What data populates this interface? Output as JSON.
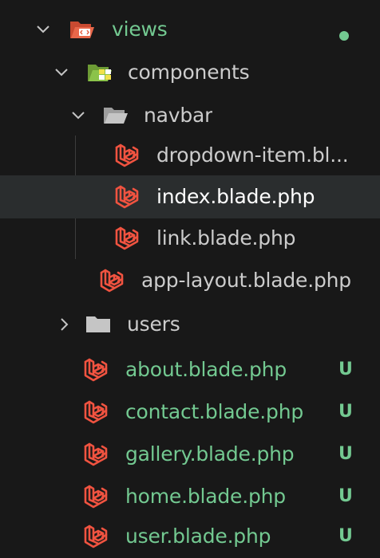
{
  "colors": {
    "background": "#181818",
    "selected_row": "#2a2d2e",
    "untracked_text": "#73c991",
    "normal_text": "#cccccc",
    "laravel_red": "#f05340",
    "folder_orange": "#e8674a",
    "folder_green": "#8bc34a",
    "folder_gray": "#c5c5c5"
  },
  "explorer": {
    "views": {
      "label": "views",
      "icon": "folder-views-open-icon",
      "status": "modified-dot"
    },
    "components": {
      "label": "components",
      "icon": "folder-components-open-icon"
    },
    "navbar": {
      "label": "navbar",
      "icon": "folder-open-icon"
    },
    "dropdown_item": {
      "label": "dropdown-item.bl...",
      "icon": "laravel-icon"
    },
    "index": {
      "label": "index.blade.php",
      "icon": "laravel-icon",
      "selected": true
    },
    "link": {
      "label": "link.blade.php",
      "icon": "laravel-icon"
    },
    "app_layout": {
      "label": "app-layout.blade.php",
      "icon": "laravel-icon"
    },
    "users": {
      "label": "users",
      "icon": "folder-closed-icon"
    },
    "about": {
      "label": "about.blade.php",
      "icon": "laravel-icon",
      "badge": "U"
    },
    "contact": {
      "label": "contact.blade.php",
      "icon": "laravel-icon",
      "badge": "U"
    },
    "gallery": {
      "label": "gallery.blade.php",
      "icon": "laravel-icon",
      "badge": "U"
    },
    "home": {
      "label": "home.blade.php",
      "icon": "laravel-icon",
      "badge": "U"
    },
    "user": {
      "label": "user.blade.php",
      "icon": "laravel-icon",
      "badge": "U"
    }
  }
}
